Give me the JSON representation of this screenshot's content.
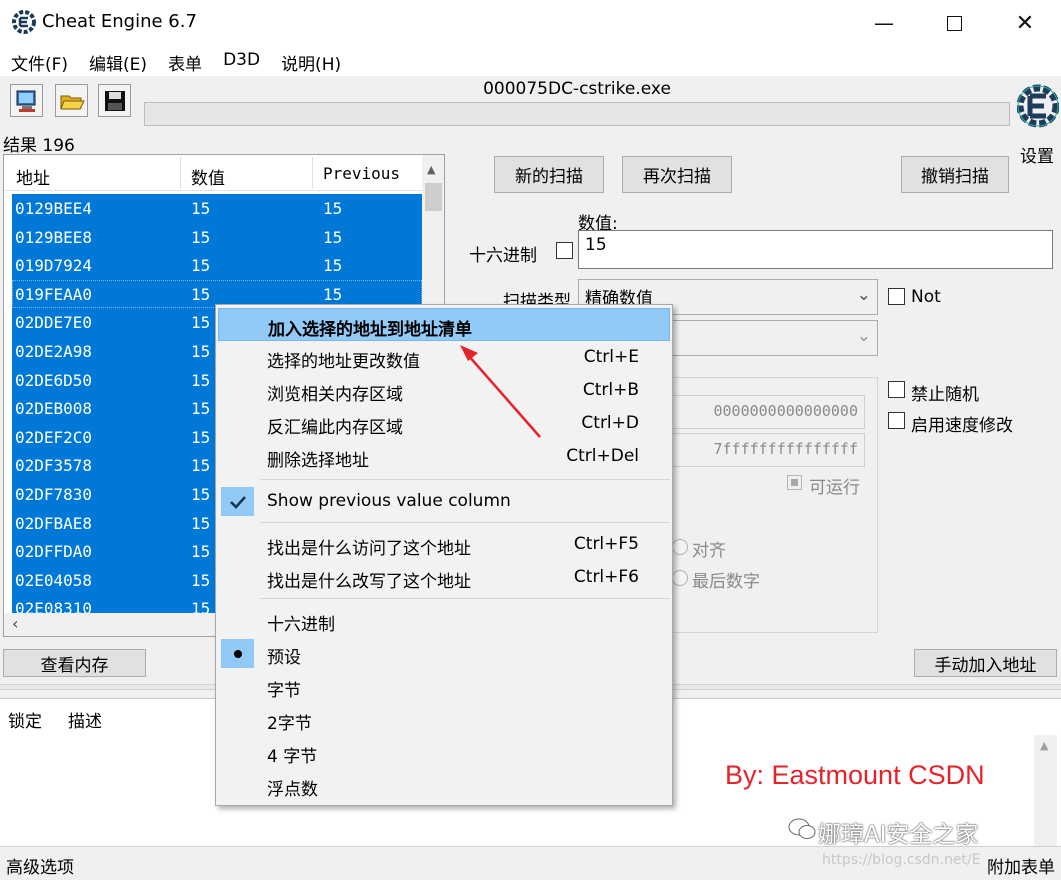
{
  "window": {
    "title": "Cheat Engine 6.7"
  },
  "menu": [
    "文件(F)",
    "编辑(E)",
    "表单",
    "D3D",
    "说明(H)"
  ],
  "toolbar": {
    "process": "000075DC-cstrike.exe",
    "settings_label": "设置"
  },
  "results": {
    "count_label": "结果 196",
    "columns": [
      "地址",
      "数值",
      "Previous"
    ],
    "rows": [
      [
        "0129BEE4",
        "15",
        "15"
      ],
      [
        "0129BEE8",
        "15",
        "15"
      ],
      [
        "019D7924",
        "15",
        "15"
      ],
      [
        "019FEAA0",
        "15",
        "15"
      ],
      [
        "02DDE7E0",
        "15",
        ""
      ],
      [
        "02DE2A98",
        "15",
        ""
      ],
      [
        "02DE6D50",
        "15",
        ""
      ],
      [
        "02DEB008",
        "15",
        ""
      ],
      [
        "02DEF2C0",
        "15",
        ""
      ],
      [
        "02DF3578",
        "15",
        ""
      ],
      [
        "02DF7830",
        "15",
        ""
      ],
      [
        "02DFBAE8",
        "15",
        ""
      ],
      [
        "02DFFDA0",
        "15",
        ""
      ],
      [
        "02E04058",
        "15",
        ""
      ],
      [
        "02E08310",
        "15",
        ""
      ]
    ]
  },
  "scan": {
    "new_scan": "新的扫描",
    "next_scan": "再次扫描",
    "undo_scan": "撤销扫描",
    "value_label": "数值:",
    "hex_label": "十六进制",
    "value": "15",
    "scan_type_label": "扫描类型",
    "scan_type_value": "精确数值",
    "not_label": "Not",
    "disable_random": "禁止随机",
    "enable_speedhack": "启用速度修改",
    "start_addr": "0000000000000000",
    "stop_addr": "7fffffffffffffff",
    "executable": "可运行",
    "align": "对齐",
    "last_digits": "最后数字"
  },
  "buttons": {
    "view_memory": "查看内存",
    "add_manual": "手动加入地址"
  },
  "address_list": {
    "columns": [
      "锁定",
      "描述"
    ]
  },
  "status": {
    "advanced": "高级选项",
    "table_extras": "附加表单"
  },
  "context_menu": [
    {
      "label": "加入选择的地址到地址清单",
      "shortcut": "",
      "highlight": true
    },
    {
      "label": "选择的地址更改数值",
      "shortcut": "Ctrl+E"
    },
    {
      "label": "浏览相关内存区域",
      "shortcut": "Ctrl+B"
    },
    {
      "label": "反汇编此内存区域",
      "shortcut": "Ctrl+D"
    },
    {
      "label": "删除选择地址",
      "shortcut": "Ctrl+Del"
    },
    {
      "label": "Show previous value column",
      "shortcut": "",
      "checked": true
    },
    {
      "label": "找出是什么访问了这个地址",
      "shortcut": "Ctrl+F5"
    },
    {
      "label": "找出是什么改写了这个地址",
      "shortcut": "Ctrl+F6"
    },
    {
      "label": "十六进制",
      "shortcut": ""
    },
    {
      "label": "预设",
      "shortcut": "",
      "selected": true
    },
    {
      "label": "字节",
      "shortcut": ""
    },
    {
      "label": "2字节",
      "shortcut": ""
    },
    {
      "label": "4 字节",
      "shortcut": ""
    },
    {
      "label": "浮点数",
      "shortcut": ""
    }
  ],
  "watermark": {
    "author": "By: Eastmount CSDN",
    "wechat": "娜璋AI安全之家",
    "csdn": "https://blog.csdn.net/E"
  },
  "colors": {
    "selection": "#0078d7",
    "menu_highlight": "#91c9f7",
    "watermark": "#e8222a"
  }
}
